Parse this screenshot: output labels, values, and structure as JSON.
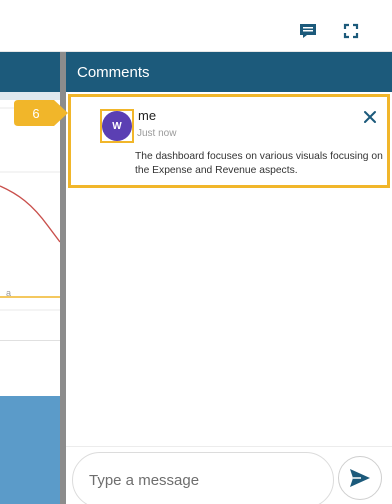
{
  "toolbar": {
    "icons": [
      "comment-icon",
      "expand-icon"
    ],
    "accent": "#1c5a7b"
  },
  "comments_panel": {
    "title": "Comments",
    "header_color": "#1c5a7b",
    "comment": {
      "avatar_initial": "W",
      "author": "me",
      "time": "Just now",
      "text": "The dashboard focuses on various visuals focusing on the Expense and Revenue aspects.",
      "close_icon": "close-icon"
    },
    "highlight_color": "#f1b62a"
  },
  "step_badge": {
    "number": "6"
  },
  "composer": {
    "placeholder": "Type a message",
    "send_icon": "send-icon"
  },
  "dashboard": {
    "cut_label": "a"
  }
}
